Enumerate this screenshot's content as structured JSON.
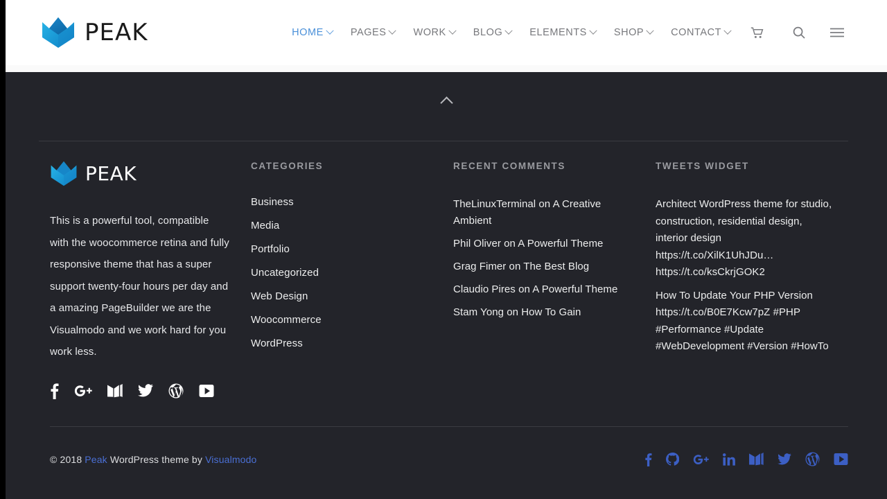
{
  "brand": {
    "name": "PEAK",
    "logo_icon": "crown-logo-icon"
  },
  "nav": {
    "items": [
      {
        "label": "HOME",
        "has_caret": true,
        "active": true
      },
      {
        "label": "PAGES",
        "has_caret": true,
        "active": false
      },
      {
        "label": "WORK",
        "has_caret": true,
        "active": false
      },
      {
        "label": "BLOG",
        "has_caret": true,
        "active": false
      },
      {
        "label": "ELEMENTS",
        "has_caret": true,
        "active": false
      },
      {
        "label": "SHOP",
        "has_caret": true,
        "active": false
      },
      {
        "label": "CONTACT",
        "has_caret": true,
        "active": false
      }
    ],
    "cart_icon": "shopping-cart-icon",
    "search_icon": "search-icon",
    "menu_icon": "hamburger-menu-icon"
  },
  "scroll_top": {
    "icon": "chevron-up-icon"
  },
  "footer": {
    "about": {
      "brand_name": "PEAK",
      "text": "This is a powerful tool, compatible with the woocommerce retina and fully responsive theme that has a super support twenty-four hours per day and a amazing PageBuilder we are the Visualmodo and we work hard for you work less.",
      "socials": [
        {
          "name": "facebook-icon"
        },
        {
          "name": "google-plus-icon"
        },
        {
          "name": "medium-icon"
        },
        {
          "name": "twitter-icon"
        },
        {
          "name": "wordpress-icon"
        },
        {
          "name": "youtube-icon"
        }
      ]
    },
    "categories": {
      "title": "CATEGORIES",
      "items": [
        "Business",
        "Media",
        "Portfolio",
        "Uncategorized",
        "Web Design",
        "Woocommerce",
        "WordPress"
      ]
    },
    "recent_comments": {
      "title": "RECENT COMMENTS",
      "items": [
        "TheLinuxTerminal on A Creative Ambient",
        "Phil Oliver on A Powerful Theme",
        "Grag Fimer on The Best Blog",
        "Claudio Pires on A Powerful Theme",
        "Stam Yong on How To Gain"
      ]
    },
    "tweets": {
      "title": "TWEETS WIDGET",
      "items": [
        "Architect WordPress theme for studio, construction, residential design, interior design https://t.co/XilK1UhJDu… https://t.co/ksCkrjGOK2",
        "How To Update Your PHP Version https://t.co/B0E7Kcw7pZ #PHP #Performance #Update #WebDevelopment #Version #HowTo"
      ]
    },
    "bottom": {
      "copyright_prefix": "© 2018 ",
      "link_peak": "Peak",
      "copyright_mid": " WordPress theme by ",
      "link_visualmodo": "Visualmodo",
      "socials": [
        {
          "name": "facebook-icon"
        },
        {
          "name": "github-icon"
        },
        {
          "name": "google-plus-icon"
        },
        {
          "name": "linkedin-icon"
        },
        {
          "name": "medium-icon"
        },
        {
          "name": "twitter-icon"
        },
        {
          "name": "wordpress-icon"
        },
        {
          "name": "youtube-icon"
        }
      ]
    }
  },
  "colors": {
    "header_bg": "#ffffff",
    "dark_bg": "#23242a",
    "accent_blue": "#4a90d9",
    "link_blue": "#4a6fd4",
    "logo_blue": "#1b9ede",
    "text_light": "#eceded",
    "title_gray": "#9a9ba0"
  }
}
